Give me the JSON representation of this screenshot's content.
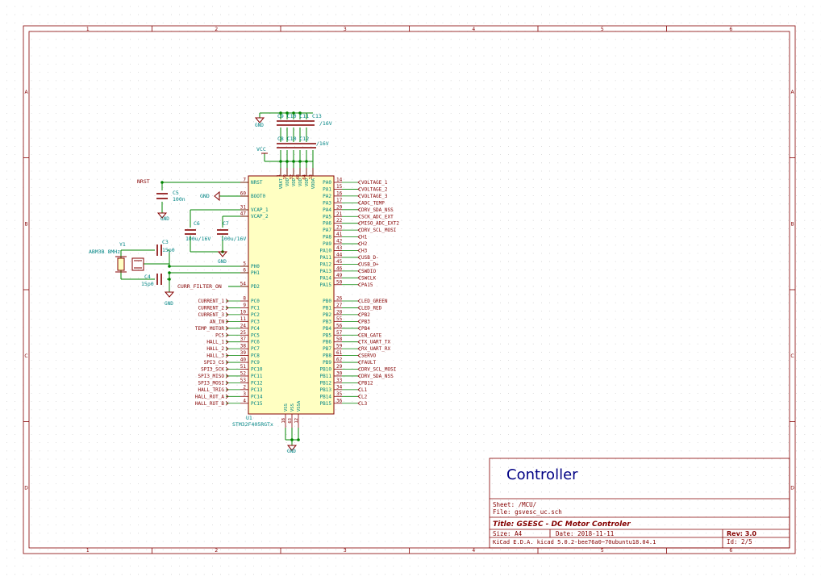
{
  "colors": {
    "frame": "#840000",
    "wire": "#008400",
    "part": "#840000",
    "part_fill": "#ffffc2",
    "pin": "#840000",
    "text": "#008484",
    "label": "#840000",
    "title": "#000084",
    "grid": "#c8c8c8"
  },
  "frame": {
    "cols": [
      "1",
      "2",
      "3",
      "4",
      "5",
      "6"
    ],
    "rows": [
      "A",
      "B",
      "C",
      "D"
    ]
  },
  "sheet": {
    "title_big": "Controller",
    "sheet_name": "Sheet: /MCU/",
    "file": "File: gsvesc_uc.sch",
    "title": "Title: GSESC - DC Motor Controler",
    "size": "Size: A4",
    "date": "Date: 2018-11-11",
    "rev": "Rev: 3.0",
    "tool": "KiCad E.D.A.  kicad 5.0.2-bee76a0~70ubuntu18.04.1",
    "id": "Id: 2/5"
  },
  "mcu": {
    "ref": "U1",
    "value": "STM32F405RGTx",
    "left_top": [
      {
        "pin": "7",
        "name": "NRST"
      },
      {
        "pin": "60",
        "name": "BOOT0"
      },
      {
        "pin": "31",
        "name": "VCAP_1"
      },
      {
        "pin": "47",
        "name": "VCAP_2"
      },
      {
        "pin": "5",
        "name": "PH0"
      },
      {
        "pin": "6",
        "name": "PH1"
      },
      {
        "pin": "54",
        "name": "PD2"
      }
    ],
    "left_pc": [
      {
        "pin": "8",
        "name": "PC0",
        "net": "CURRENT_1"
      },
      {
        "pin": "9",
        "name": "PC1",
        "net": "CURRENT_2"
      },
      {
        "pin": "10",
        "name": "PC2",
        "net": "CURRENT_3"
      },
      {
        "pin": "11",
        "name": "PC3",
        "net": "AN_IN"
      },
      {
        "pin": "24",
        "name": "PC4",
        "net": "TEMP_MOTOR"
      },
      {
        "pin": "25",
        "name": "PC5",
        "net": "PC5"
      },
      {
        "pin": "37",
        "name": "PC6",
        "net": "HALL_1"
      },
      {
        "pin": "38",
        "name": "PC7",
        "net": "HALL_2"
      },
      {
        "pin": "39",
        "name": "PC8",
        "net": "HALL_3"
      },
      {
        "pin": "40",
        "name": "PC9",
        "net": "SPI3_CS"
      },
      {
        "pin": "51",
        "name": "PC10",
        "net": "SPI3_SCK"
      },
      {
        "pin": "52",
        "name": "PC11",
        "net": "SPI3_MISO"
      },
      {
        "pin": "53",
        "name": "PC12",
        "net": "SPI3_MOSI"
      },
      {
        "pin": "2",
        "name": "PC13",
        "net": "HALL_TRIG"
      },
      {
        "pin": "3",
        "name": "PC14",
        "net": "HALL_ROT_A"
      },
      {
        "pin": "4",
        "name": "PC15",
        "net": "HALL_ROT_B"
      }
    ],
    "right_pa": [
      {
        "pin": "14",
        "name": "PA0",
        "net": "VOLTAGE_1"
      },
      {
        "pin": "15",
        "name": "PA1",
        "net": "VOLTAGE_2"
      },
      {
        "pin": "16",
        "name": "PA2",
        "net": "VOLTAGE_3"
      },
      {
        "pin": "17",
        "name": "PA3",
        "net": "ADC_TEMP"
      },
      {
        "pin": "20",
        "name": "PA4",
        "net": "DRV_SDA_NSS"
      },
      {
        "pin": "21",
        "name": "PA5",
        "net": "SCK_ADC_EXT"
      },
      {
        "pin": "22",
        "name": "PA6",
        "net": "MISO_ADC_EXT2"
      },
      {
        "pin": "23",
        "name": "PA7",
        "net": "DRV_SCL_MOSI"
      },
      {
        "pin": "41",
        "name": "PA8",
        "net": "H1"
      },
      {
        "pin": "42",
        "name": "PA9",
        "net": "H2"
      },
      {
        "pin": "43",
        "name": "PA10",
        "net": "H3"
      },
      {
        "pin": "44",
        "name": "PA11",
        "net": "USB_D-"
      },
      {
        "pin": "45",
        "name": "PA12",
        "net": "USB_D+"
      },
      {
        "pin": "46",
        "name": "PA13",
        "net": "SWDIO"
      },
      {
        "pin": "49",
        "name": "PA14",
        "net": "SWCLK"
      },
      {
        "pin": "50",
        "name": "PA15",
        "net": "PA15"
      }
    ],
    "right_pb": [
      {
        "pin": "26",
        "name": "PB0",
        "net": "LED_GREEN"
      },
      {
        "pin": "27",
        "name": "PB1",
        "net": "LED_RED"
      },
      {
        "pin": "28",
        "name": "PB2",
        "net": "PB2"
      },
      {
        "pin": "55",
        "name": "PB3",
        "net": "PB3"
      },
      {
        "pin": "56",
        "name": "PB4",
        "net": "PB4"
      },
      {
        "pin": "57",
        "name": "PB5",
        "net": "EN_GATE"
      },
      {
        "pin": "58",
        "name": "PB6",
        "net": "TX_UART_TX"
      },
      {
        "pin": "59",
        "name": "PB7",
        "net": "RX_UART_RX"
      },
      {
        "pin": "61",
        "name": "PB8",
        "net": "SERVO"
      },
      {
        "pin": "62",
        "name": "PB9",
        "net": "FAULT"
      },
      {
        "pin": "29",
        "name": "PB10",
        "net": "DRV_SCL_MOSI"
      },
      {
        "pin": "30",
        "name": "PB11",
        "net": "DRV_SDA_NSS"
      },
      {
        "pin": "33",
        "name": "PB12",
        "net": "PB12"
      },
      {
        "pin": "34",
        "name": "PB13",
        "net": "L1"
      },
      {
        "pin": "35",
        "name": "PB14",
        "net": "L2"
      },
      {
        "pin": "36",
        "name": "PB15",
        "net": "L3"
      }
    ],
    "top_pins": [
      {
        "pin": "1",
        "name": "VBAT"
      },
      {
        "pin": "19",
        "name": "VDD"
      },
      {
        "pin": "32",
        "name": "VDD"
      },
      {
        "pin": "48",
        "name": "VDD"
      },
      {
        "pin": "64",
        "name": "VDD"
      },
      {
        "pin": "13",
        "name": "VDDA"
      }
    ],
    "bottom_pins": [
      {
        "pin": "18",
        "name": "VSS"
      },
      {
        "pin": "63",
        "name": "VSS"
      },
      {
        "pin": "12",
        "name": "VSSA"
      }
    ]
  },
  "nets": {
    "nrst": "NRST",
    "curr_filter": "CURR_FILTER_ON",
    "gnd": "GND",
    "vcc": "VCC"
  },
  "components": {
    "c5": {
      "ref": "C5",
      "value": "100n"
    },
    "c6": {
      "ref": "C6",
      "value": "100u/16V"
    },
    "c7": {
      "ref": "C7",
      "value": "100u/16V"
    },
    "c3": {
      "ref": "C3",
      "value": "15p0"
    },
    "c4": {
      "ref": "C4",
      "value": "15p0"
    },
    "y1": {
      "ref": "Y1",
      "value": "ABM3B 8MHz"
    },
    "cap_top": {
      "refs": "C9 C10 C11 C13",
      "value": "/16V"
    },
    "cap_mid": {
      "refs": "C8 C10 C12",
      "value": "/16V"
    }
  }
}
